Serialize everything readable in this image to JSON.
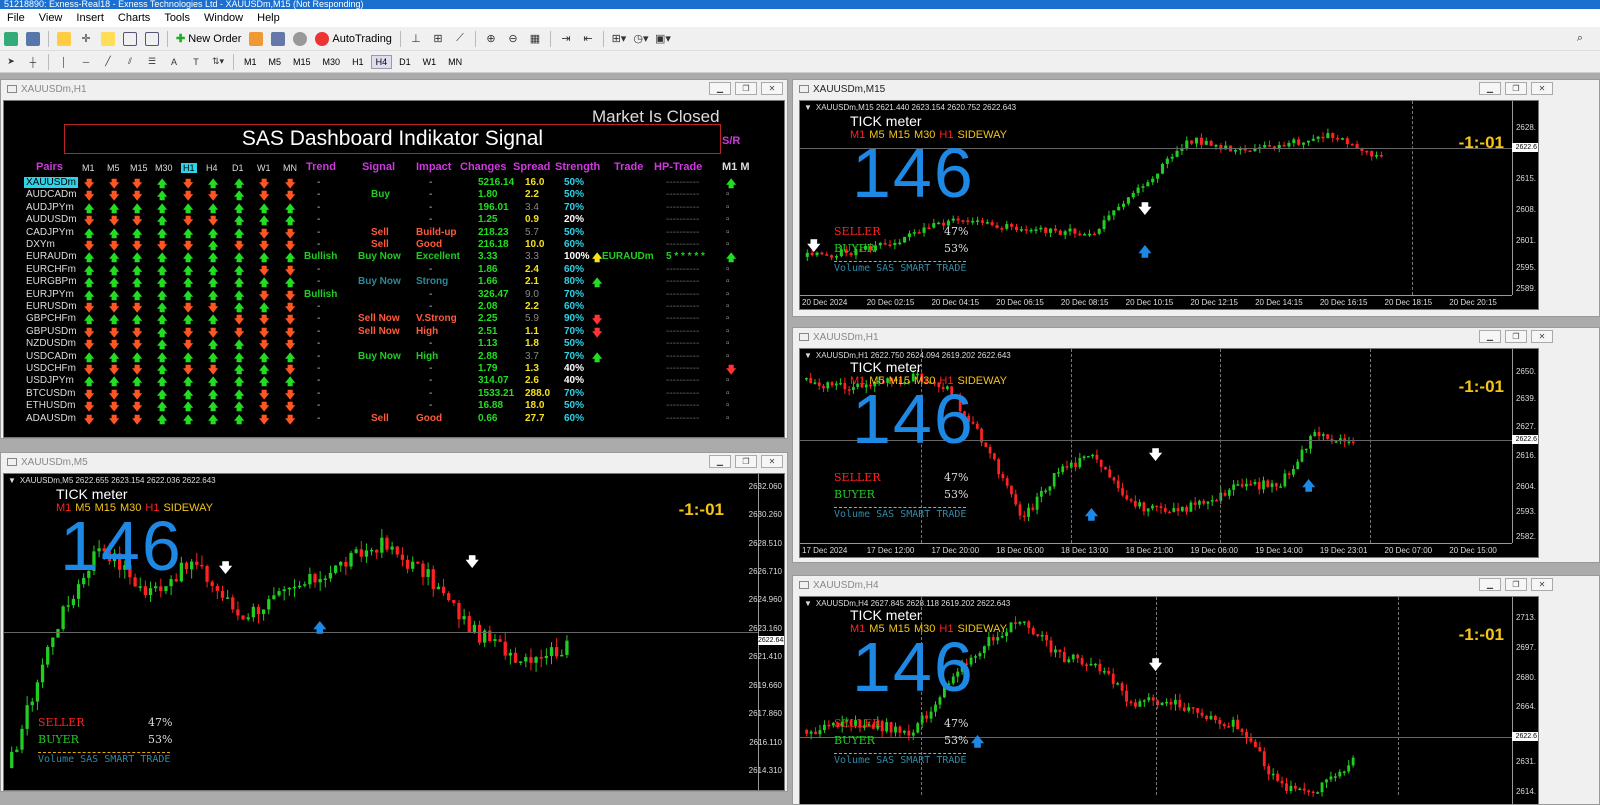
{
  "window": {
    "title": "51218890: Exness-Real18 - Exness Technologies Ltd - XAUUSDm,M15 (Not Responding)"
  },
  "menu": [
    "File",
    "View",
    "Insert",
    "Charts",
    "Tools",
    "Window",
    "Help"
  ],
  "toolbar": {
    "new_order": "New Order",
    "auto_trading": "AutoTrading"
  },
  "timeframes": [
    "M1",
    "M5",
    "M15",
    "M30",
    "H1",
    "H4",
    "D1",
    "W1",
    "MN"
  ],
  "windows": {
    "h1_dashboard": {
      "title": "XAUUSDm,H1",
      "dash_title": "SAS Dashboard Indikator Signal",
      "market_status": "Market Is Closed",
      "sr_label": "S/R",
      "headers": {
        "pairs": "Pairs",
        "trend": "Trend",
        "signal": "Signal",
        "impact": "Impact",
        "changes": "Changes",
        "spread": "Spread",
        "strength": "Strength",
        "trade": "Trade",
        "hp_trade": "HP-Trade",
        "m1": "M1 M"
      },
      "tf_headers": [
        "M1",
        "M5",
        "M15",
        "M30",
        "H1",
        "H4",
        "D1",
        "W1",
        "MN"
      ],
      "rows": [
        {
          "pair": "XAUUSDm",
          "arrows": "ddduduudd",
          "trend": "-",
          "signal": "",
          "impact": "-",
          "change": "5216.14",
          "spread": "16.0",
          "spread_hl": true,
          "strength": "50%",
          "trade": "",
          "hp": "----------",
          "sr": "up"
        },
        {
          "pair": "AUDCADm",
          "arrows": "ddduddudd",
          "trend": "-",
          "signal": "Buy",
          "sig": "buy-w",
          "impact": "-",
          "change": "1.80",
          "spread": "2.2",
          "spread_hl": true,
          "strength": "50%",
          "trade": "",
          "hp": "----------",
          "sr": "box"
        },
        {
          "pair": "AUDJPYm",
          "arrows": "uuuuuuuuu",
          "trend": "-",
          "signal": "",
          "impact": "-",
          "change": "196.01",
          "spread": "3.4",
          "spread_hl": false,
          "strength": "70%",
          "trade": "",
          "hp": "----------",
          "sr": "box"
        },
        {
          "pair": "AUDUSDm",
          "arrows": "dddudduuu",
          "trend": "-",
          "signal": "",
          "impact": "-",
          "change": "1.25",
          "spread": "0.9",
          "spread_hl": true,
          "strength": "20%",
          "strength_white": true,
          "trade": "",
          "hp": "----------",
          "sr": "box"
        },
        {
          "pair": "CADJPYm",
          "arrows": "uuuuuuudd",
          "trend": "-",
          "signal": "Sell",
          "sig": "sell",
          "impact": "Build-up",
          "imp": "red",
          "change": "218.23",
          "spread": "5.7",
          "spread_hl": false,
          "strength": "50%",
          "trade": "",
          "hp": "----------",
          "sr": "box"
        },
        {
          "pair": "DXYm",
          "arrows": "ddddduddd",
          "trend": "-",
          "signal": "Sell",
          "sig": "sell",
          "impact": "Good",
          "imp": "red",
          "change": "216.18",
          "spread": "10.0",
          "spread_hl": true,
          "strength": "60%",
          "trade": "",
          "hp": "----------",
          "sr": "box"
        },
        {
          "pair": "EURAUDm",
          "arrows": "uuuuuuuuu",
          "trend": "Bullish",
          "signal": "Buy Now",
          "sig": "buy",
          "impact": "Excellent",
          "imp": "green",
          "change": "3.33",
          "spread": "3.3",
          "spread_hl": false,
          "strength": "100%",
          "strength_white": true,
          "trade": "EURAUDm",
          "hp": "5 * * * * *",
          "sr": "up",
          "trade_arrow": "up"
        },
        {
          "pair": "EURCHFm",
          "arrows": "uuuuuuudd",
          "trend": "-",
          "signal": "",
          "impact": "-",
          "change": "1.86",
          "spread": "2.4",
          "spread_hl": true,
          "strength": "60%",
          "trade": "",
          "hp": "----------",
          "sr": "box"
        },
        {
          "pair": "EURGBPm",
          "arrows": "uuuuuuuuu",
          "trend": "-",
          "signal": "Buy Now",
          "sig": "buy-teal",
          "impact": "Strong",
          "imp": "teal",
          "change": "1.66",
          "spread": "2.1",
          "spread_hl": true,
          "strength": "80%",
          "trade": "",
          "hp": "----------",
          "sr": "box",
          "trade_arrow": "up"
        },
        {
          "pair": "EURJPYm",
          "arrows": "uuuuuuudd",
          "trend": "Bullish",
          "signal": "",
          "impact": "-",
          "change": "326.47",
          "spread": "9.0",
          "spread_hl": false,
          "strength": "70%",
          "trade": "",
          "hp": "----------",
          "sr": "box"
        },
        {
          "pair": "EURUSDm",
          "arrows": "dddudduud",
          "trend": "-",
          "signal": "",
          "impact": "-",
          "change": "2.08",
          "spread": "2.2",
          "spread_hl": true,
          "strength": "60%",
          "trade": "",
          "hp": "----------",
          "sr": "box"
        },
        {
          "pair": "GBPCHFm",
          "arrows": "uuuuuuddd",
          "trend": "-",
          "signal": "Sell Now",
          "sig": "sell",
          "impact": "V.Strong",
          "imp": "red",
          "change": "2.25",
          "spread": "5.9",
          "spread_hl": false,
          "strength": "90%",
          "trade": "",
          "hp": "----------",
          "sr": "box",
          "trade_arrow": "down"
        },
        {
          "pair": "GBPUSDm",
          "arrows": "ddduddddd",
          "trend": "-",
          "signal": "Sell Now",
          "sig": "sell",
          "impact": "High",
          "imp": "red",
          "change": "2.51",
          "spread": "1.1",
          "spread_hl": true,
          "strength": "70%",
          "trade": "",
          "hp": "----------",
          "sr": "box",
          "trade_arrow": "down"
        },
        {
          "pair": "NZDUSDm",
          "arrows": "ddduduudd",
          "trend": "-",
          "signal": "",
          "impact": "-",
          "change": "1.13",
          "spread": "1.8",
          "spread_hl": true,
          "strength": "50%",
          "trade": "",
          "hp": "----------",
          "sr": "box"
        },
        {
          "pair": "USDCADm",
          "arrows": "uuuuuuuuu",
          "trend": "-",
          "signal": "Buy Now",
          "sig": "buy",
          "impact": "High",
          "imp": "green",
          "change": "2.88",
          "spread": "3.7",
          "spread_hl": false,
          "strength": "70%",
          "trade": "",
          "hp": "----------",
          "sr": "box",
          "trade_arrow": "up"
        },
        {
          "pair": "USDCHFm",
          "arrows": "dddudduud",
          "trend": "-",
          "signal": "",
          "impact": "-",
          "change": "1.79",
          "spread": "1.3",
          "spread_hl": true,
          "strength": "40%",
          "strength_white": true,
          "trade": "",
          "hp": "----------",
          "sr": "down"
        },
        {
          "pair": "USDJPYm",
          "arrows": "uuuuuuuuu",
          "trend": "-",
          "signal": "",
          "impact": "-",
          "change": "314.07",
          "spread": "2.6",
          "spread_hl": true,
          "strength": "40%",
          "strength_white": true,
          "trade": "",
          "hp": "----------",
          "sr": "box"
        },
        {
          "pair": "BTCUSDm",
          "arrows": "ddduuuudd",
          "trend": "-",
          "signal": "",
          "impact": "-",
          "change": "1533.21",
          "spread": "288.0",
          "spread_hl": true,
          "strength": "70%",
          "trade": "",
          "hp": "----------",
          "sr": "box"
        },
        {
          "pair": "ETHUSDm",
          "arrows": "ddduuuudd",
          "trend": "-",
          "signal": "",
          "impact": "-",
          "change": "16.88",
          "spread": "18.0",
          "spread_hl": true,
          "strength": "50%",
          "trade": "",
          "hp": "----------",
          "sr": "box"
        },
        {
          "pair": "ADAUSDm",
          "arrows": "ddduuuudd",
          "trend": "-",
          "signal": "Sell",
          "sig": "sell",
          "impact": "Good",
          "imp": "red",
          "change": "0.66",
          "spread": "27.7",
          "spread_hl": true,
          "strength": "60%",
          "trade": "",
          "hp": "----------",
          "sr": "box"
        }
      ]
    },
    "m5": {
      "title": "XAUUSDm,M5",
      "label": "XAUUSDm,M5  2622.655 2623.154 2622.036 2622.643",
      "prices": [
        "2632.060",
        "2630.260",
        "2628.510",
        "2626.710",
        "2624.960",
        "2623.160",
        "2622.643",
        "2621.410",
        "2619.660",
        "2617.860",
        "2616.110",
        "2614.310"
      ]
    },
    "m15": {
      "title": "XAUUSDm,M15",
      "label": "XAUUSDm,M15  2621.440 2623.154 2620.752 2622.643",
      "prices": [
        "2628.",
        "2622.6",
        "2615.",
        "2608.",
        "2601.",
        "2595.",
        "2589."
      ],
      "times": [
        "20 Dec 2024",
        "20 Dec 02:15",
        "20 Dec 04:15",
        "20 Dec 06:15",
        "20 Dec 08:15",
        "20 Dec 10:15",
        "20 Dec 12:15",
        "20 Dec 14:15",
        "20 Dec 16:15",
        "20 Dec 18:15",
        "20 Dec 20:15"
      ]
    },
    "h1": {
      "title": "XAUUSDm,H1",
      "label": "XAUUSDm,H1  2622.750 2624.094 2619.202 2622.643",
      "prices": [
        "2650.",
        "2639.",
        "2627.",
        "2622.6",
        "2616.",
        "2604.",
        "2593.",
        "2582."
      ],
      "times": [
        "17 Dec 2024",
        "17 Dec 12:00",
        "17 Dec 20:00",
        "18 Dec 05:00",
        "18 Dec 13:00",
        "18 Dec 21:00",
        "19 Dec 06:00",
        "19 Dec 14:00",
        "19 Dec 23:01",
        "20 Dec 07:00",
        "20 Dec 15:00"
      ]
    },
    "h4": {
      "title": "XAUUSDm,H4",
      "label": "XAUUSDm,H4  2627.845 2628.118 2619.202 2622.643",
      "prices": [
        "2713.",
        "2697.",
        "2680.",
        "2664.",
        "2647.",
        "2631.",
        "2622.6",
        "2614."
      ]
    }
  },
  "indicator": {
    "tick_title": "TICK meter",
    "tf_labels": [
      "M1",
      "M5",
      "M15",
      "M30",
      "H1"
    ],
    "sideway": "SIDEWAY",
    "tick_value": "146",
    "ratio": "-1:-01",
    "seller_label": "SELLER",
    "seller_pct": "47%",
    "buyer_label": "BUYER",
    "buyer_pct": "53%",
    "volume_text": "Volume SAS SMART TRADE"
  },
  "colors": {
    "up": "#22cc22",
    "down": "#ff2222",
    "accent_blue": "#1e88e5",
    "gold": "#f5c518"
  }
}
